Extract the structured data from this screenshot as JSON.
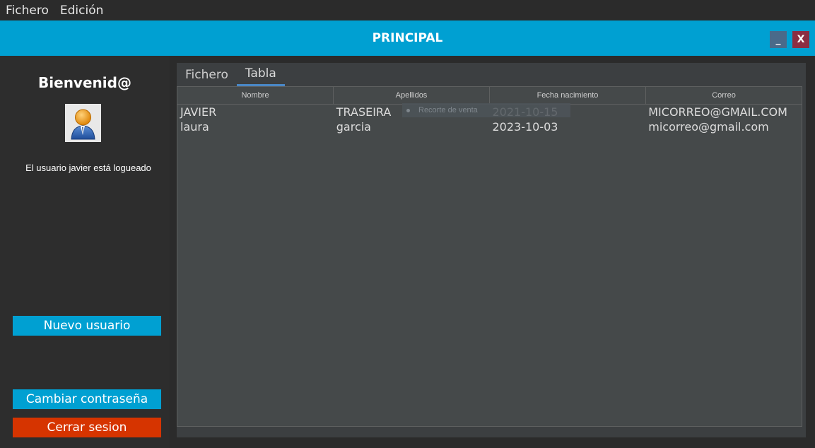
{
  "menubar": {
    "items": [
      "Fichero",
      "Edición"
    ]
  },
  "window": {
    "title": "PRINCIPAL",
    "minimize_label": "_",
    "close_label": "X"
  },
  "sidebar": {
    "welcome": "Bienvenid@",
    "status": "El usuario javier está logueado",
    "new_user_label": "Nuevo usuario",
    "change_password_label": "Cambiar contraseña",
    "logout_label": "Cerrar sesion"
  },
  "tabs": [
    {
      "label": "Fichero",
      "active": false
    },
    {
      "label": "Tabla",
      "active": true
    }
  ],
  "table": {
    "columns": [
      "Nombre",
      "Apellidos",
      "Fecha nacimiento",
      "Correo"
    ],
    "rows": [
      [
        "JAVIER",
        "TRASEIRA",
        "2021-10-15",
        "MICORREO@GMAIL.COM"
      ],
      [
        "laura",
        "garcia",
        "2023-10-03",
        "micorreo@gmail.com"
      ]
    ]
  },
  "overlay": {
    "label": "Recorte de venta"
  },
  "colors": {
    "accent": "#00a0d2",
    "danger": "#d63400",
    "close_button": "#8c2d42",
    "minimize_button": "#4a6a8a"
  }
}
